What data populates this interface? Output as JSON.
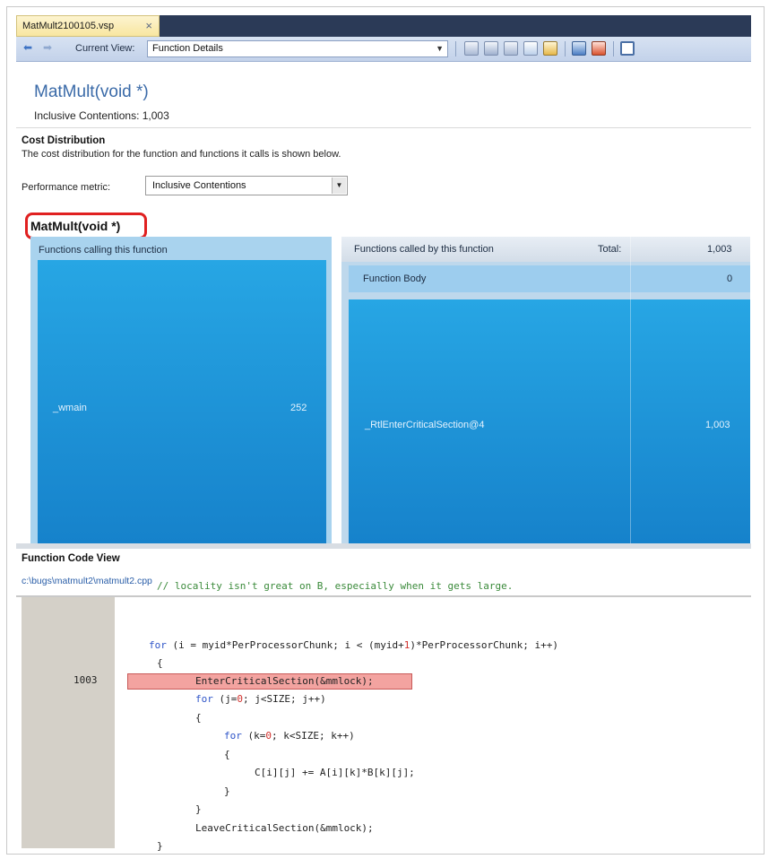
{
  "document_tab": {
    "title": "MatMult2100105.vsp",
    "close_glyph": "×"
  },
  "toolbar": {
    "current_view_label": "Current View:",
    "current_view_value": "Function Details"
  },
  "header": {
    "function_title": "MatMult(void *)",
    "inclusive_contentions": "Inclusive Contentions: 1,003"
  },
  "cost_distribution": {
    "title": "Cost Distribution",
    "description": "The cost distribution for the function and functions it calls is shown below.",
    "metric_label": "Performance metric:",
    "metric_value": "Inclusive Contentions",
    "function_heading": "MatMult(void *)"
  },
  "callers": {
    "title": "Functions calling this function",
    "items": [
      {
        "name": "_wmain",
        "value": "252"
      }
    ]
  },
  "callees": {
    "title": "Functions called by this function",
    "total_label": "Total:",
    "total_value": "1,003",
    "function_body": {
      "name": "Function Body",
      "value": "0"
    },
    "items": [
      {
        "name": "_RtlEnterCriticalSection@4",
        "value": "1,003"
      }
    ]
  },
  "code_view": {
    "title": "Function Code View",
    "path": "c:\\bugs\\matmult2\\matmult2.cpp",
    "highlight_line_number": "1003",
    "lines": [
      "// locality isn't great on B, especially when it gets large.",
      "for (i = myid*PerProcessorChunk; i < (myid+1)*PerProcessorChunk; i++)",
      "{",
      "EnterCriticalSection(&mmlock);",
      "for (j=0; j<SIZE; j++)",
      "{",
      "for (k=0; k<SIZE; k++)",
      "{",
      "C[i][j] += A[i][k]*B[k][j];",
      "}",
      "}",
      "LeaveCriticalSection(&mmlock);",
      "}"
    ]
  },
  "colors": {
    "accent_blue": "#1a8fd6",
    "highlight_red": "#f3a3a0",
    "title_blue": "#3a6aa8",
    "callout_red": "#e02020"
  }
}
